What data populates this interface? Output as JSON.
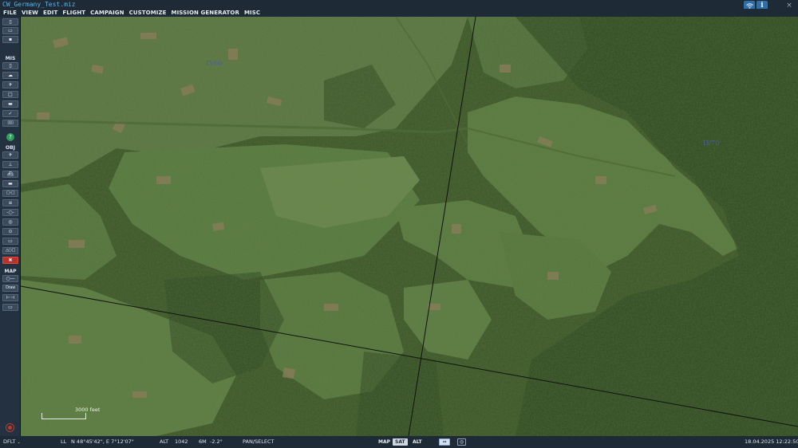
{
  "window": {
    "title": "CW_Germany_Test.miz",
    "close_glyph": "×",
    "wifi_icon": "wifi-icon",
    "info_icon": "info-icon",
    "info_glyph": "i"
  },
  "menu": [
    "FILE",
    "VIEW",
    "EDIT",
    "FLIGHT",
    "CAMPAIGN",
    "CUSTOMIZE",
    "MISSION GENERATOR",
    "MISC"
  ],
  "toolbar": {
    "sections": {
      "mis": "MIS",
      "obj": "OBJ",
      "map": "MAP"
    },
    "draw_label": "Draw",
    "file_buttons": [
      "new-file-icon",
      "open-file-icon",
      "save-file-icon"
    ],
    "mis_buttons": [
      "briefing-icon",
      "weather-icon",
      "aircraft-icon",
      "trigger-icon",
      "resource-icon",
      "check-icon",
      "zones-icon"
    ],
    "obj_buttons": [
      "plane-icon",
      "helicopter-icon",
      "ship-icon",
      "vehicle-icon",
      "static-icon",
      "farp-icon",
      "target-icon",
      "zone-icon",
      "nav-icon",
      "group-icon",
      "delete-icon"
    ],
    "map_buttons": [
      "ruler-icon",
      "draw-icon",
      "bullseye-icon",
      "layers-icon"
    ]
  },
  "map": {
    "labels": [
      {
        "text": "LV60"
      },
      {
        "text": "LV70"
      }
    ],
    "scale": "3000 feet"
  },
  "status": {
    "profile": "DFLT",
    "coords_label": "LL",
    "coords": "N 48°45'42\", E 7°12'07\"",
    "alt_label": "ALT",
    "alt_value": "1042",
    "mag_label": "6M",
    "mag_value": "-2.2°",
    "mode": "PAN/SELECT",
    "toggles": [
      {
        "label": "MAP",
        "active": false
      },
      {
        "label": "SAT",
        "active": true
      },
      {
        "label": "ALT",
        "active": false
      }
    ],
    "datetime": "18.04.2025 12:22:50"
  }
}
